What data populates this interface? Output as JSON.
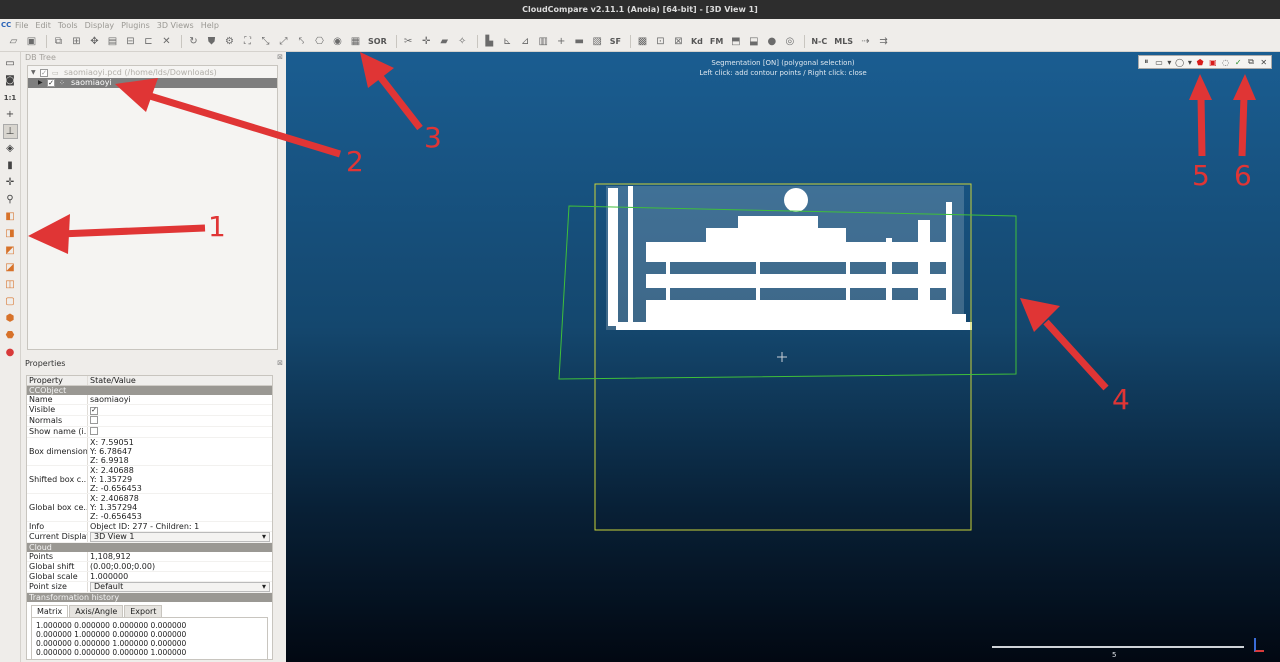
{
  "title": "CloudCompare v2.11.1 (Anoia) [64-bit] - [3D View 1]",
  "menu": [
    "File",
    "Edit",
    "Tools",
    "Display",
    "Plugins",
    "3D Views",
    "Help"
  ],
  "toolbar_text_buttons": [
    "SOR",
    "SF",
    "Kd",
    "FM",
    "N-C",
    "MLS"
  ],
  "db_tree": {
    "title": "DB Tree",
    "items": [
      {
        "label": "saomiaoyi.pcd (/home/lds/Downloads)",
        "checked": true,
        "selected": false
      },
      {
        "label": "saomiaoyi",
        "checked": true,
        "selected": true
      }
    ]
  },
  "properties": {
    "title": "Properties",
    "headers": [
      "Property",
      "State/Value"
    ],
    "sections": [
      {
        "name": "CCObject",
        "rows": [
          {
            "label": "Name",
            "value": "saomiaoyi"
          },
          {
            "label": "Visible",
            "checkbox": true
          },
          {
            "label": "Normals",
            "checkbox": false
          },
          {
            "label": "Show name (i...",
            "checkbox": false
          },
          {
            "label": "Box dimensions",
            "values": [
              "X: 7.59051",
              "Y: 6.78647",
              "Z: 6.9918"
            ]
          },
          {
            "label": "Shifted box c...",
            "values": [
              "X: 2.40688",
              "Y: 1.35729",
              "Z: -0.656453"
            ]
          },
          {
            "label": "Global box ce...",
            "values": [
              "X: 2.406878",
              "Y: 1.357294",
              "Z: -0.656453"
            ]
          },
          {
            "label": "Info",
            "value": "Object ID: 277 - Children: 1"
          },
          {
            "label": "Current Display",
            "combo": "3D View 1"
          }
        ]
      },
      {
        "name": "Cloud",
        "rows": [
          {
            "label": "Points",
            "value": "1,108,912"
          },
          {
            "label": "Global shift",
            "value": "(0.00;0.00;0.00)"
          },
          {
            "label": "Global scale",
            "value": "1.000000"
          },
          {
            "label": "Point size",
            "combo": "Default"
          }
        ]
      },
      {
        "name": "Transformation history",
        "rows": []
      }
    ],
    "tabs": [
      "Matrix",
      "Axis/Angle",
      "Export"
    ],
    "active_tab": "Matrix",
    "matrix": [
      "1.000000 0.000000 0.000000 0.000000",
      "0.000000 1.000000 0.000000 0.000000",
      "0.000000 0.000000 1.000000 0.000000",
      "0.000000 0.000000 0.000000 1.000000"
    ]
  },
  "view3d": {
    "status_line1": "Segmentation [ON] (polygonal selection)",
    "status_line2": "Left click: add contour points / Right click: close",
    "scale_label": "5"
  },
  "annotations": [
    "1",
    "2",
    "3",
    "4",
    "5",
    "6"
  ],
  "colors": {
    "accent_red": "#e03535",
    "bbox_yellow": "#c8d23a",
    "bbox_green": "#3fbf3a",
    "selection_red": "#d81b1b"
  }
}
